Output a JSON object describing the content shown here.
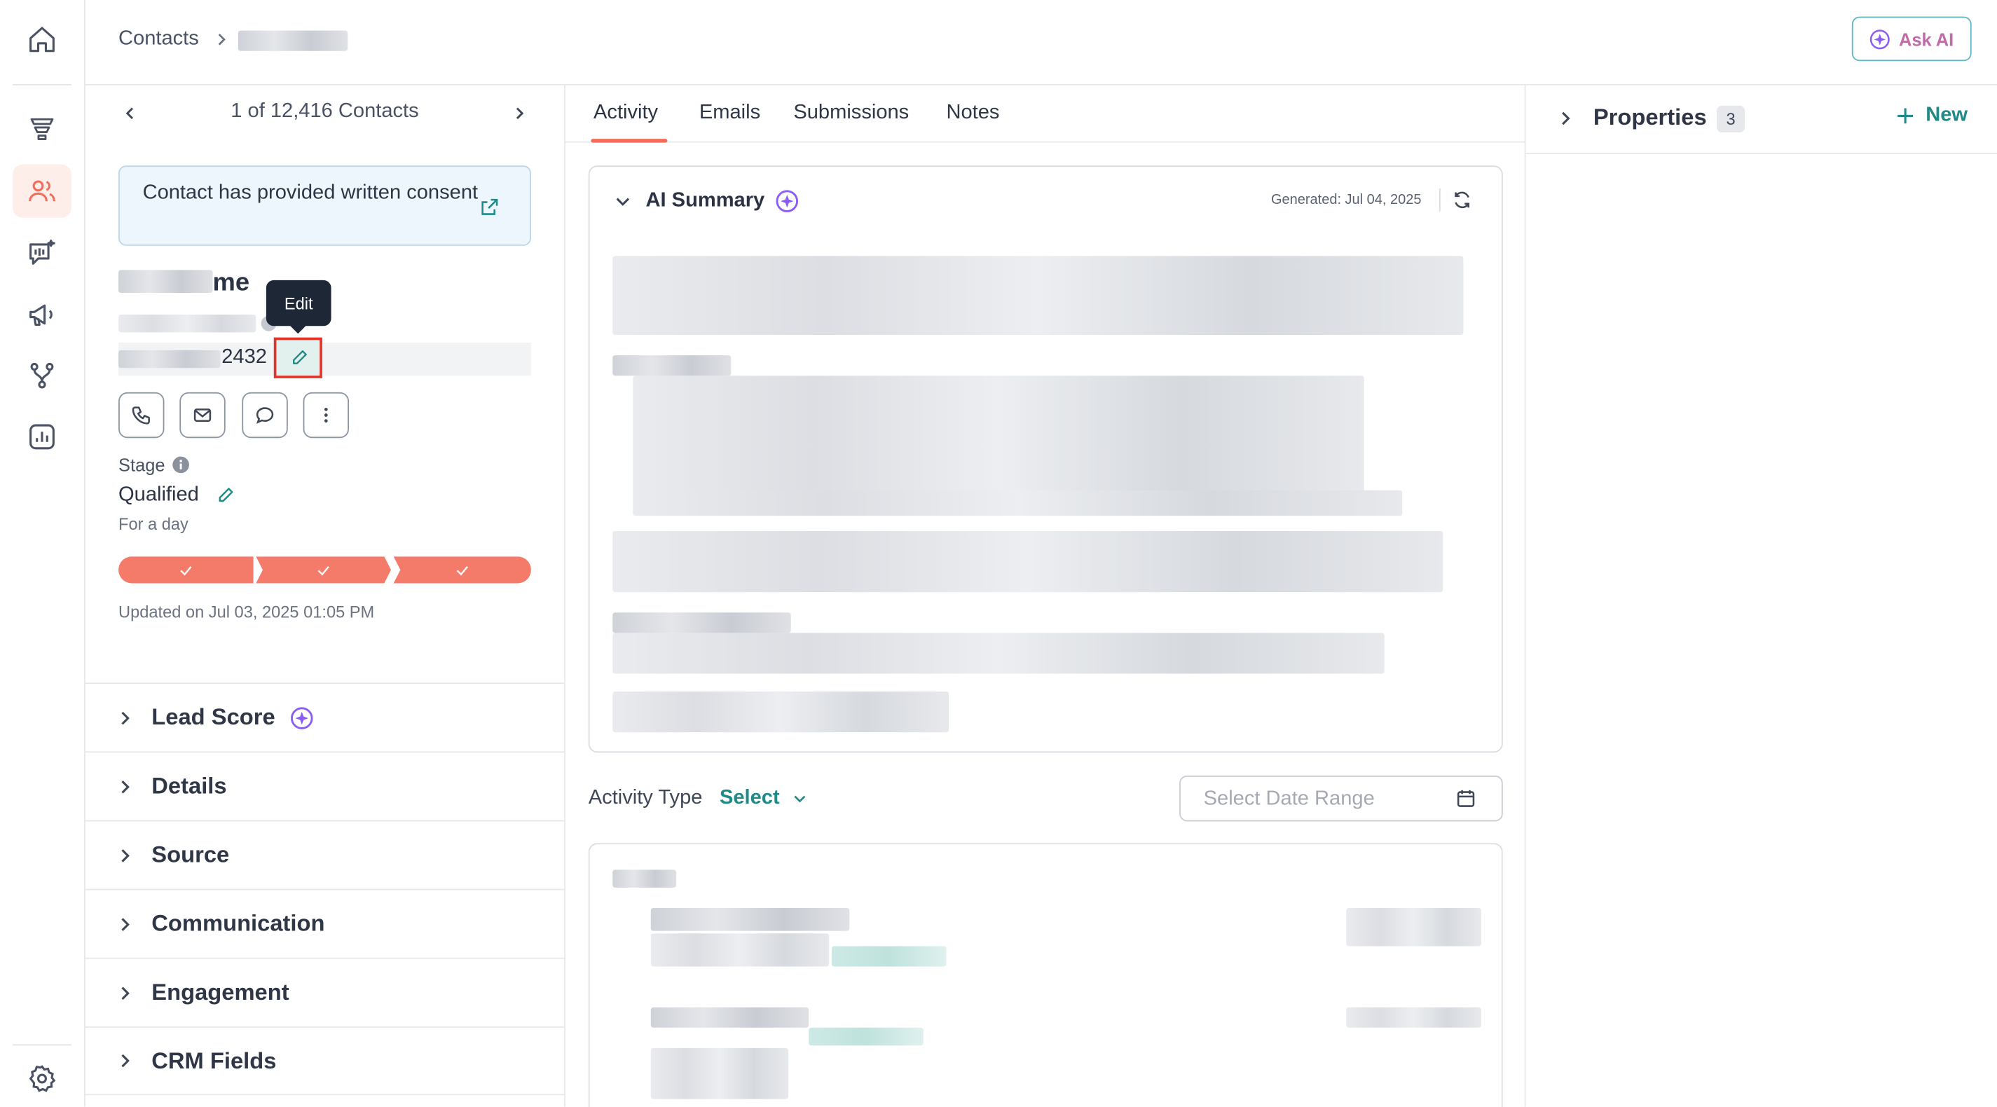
{
  "header": {
    "breadcrumb_root": "Contacts",
    "ask_ai_label": "Ask AI"
  },
  "nav": {
    "counter": "1 of 12,416 Contacts"
  },
  "contact": {
    "consent_text": "Contact has provided written consent",
    "name_suffix": "me",
    "phone_suffix": "2432",
    "tooltip_edit": "Edit",
    "stage_label": "Stage",
    "stage_value": "Qualified",
    "stage_duration": "For a day",
    "progress_steps_completed": 3,
    "progress_steps_total": 3,
    "updated_on": "Updated on Jul 03, 2025 01:05 PM"
  },
  "sections": [
    "Lead Score",
    "Details",
    "Source",
    "Communication",
    "Engagement",
    "CRM Fields"
  ],
  "tabs": [
    "Activity",
    "Emails",
    "Submissions",
    "Notes"
  ],
  "active_tab": "Activity",
  "ai_summary": {
    "title": "AI Summary",
    "generated": "Generated: Jul 04, 2025"
  },
  "activity_filter": {
    "label": "Activity Type",
    "select_label": "Select",
    "date_placeholder": "Select Date Range"
  },
  "properties": {
    "title": "Properties",
    "count": "3",
    "new_label": "New"
  },
  "colors": {
    "accent_teal": "#1f8a87",
    "stage_progress": "#f47a6a",
    "tab_underline": "#f26d5b",
    "tooltip_bg": "#1d2736",
    "ai_purple": "#8b5cf6"
  }
}
